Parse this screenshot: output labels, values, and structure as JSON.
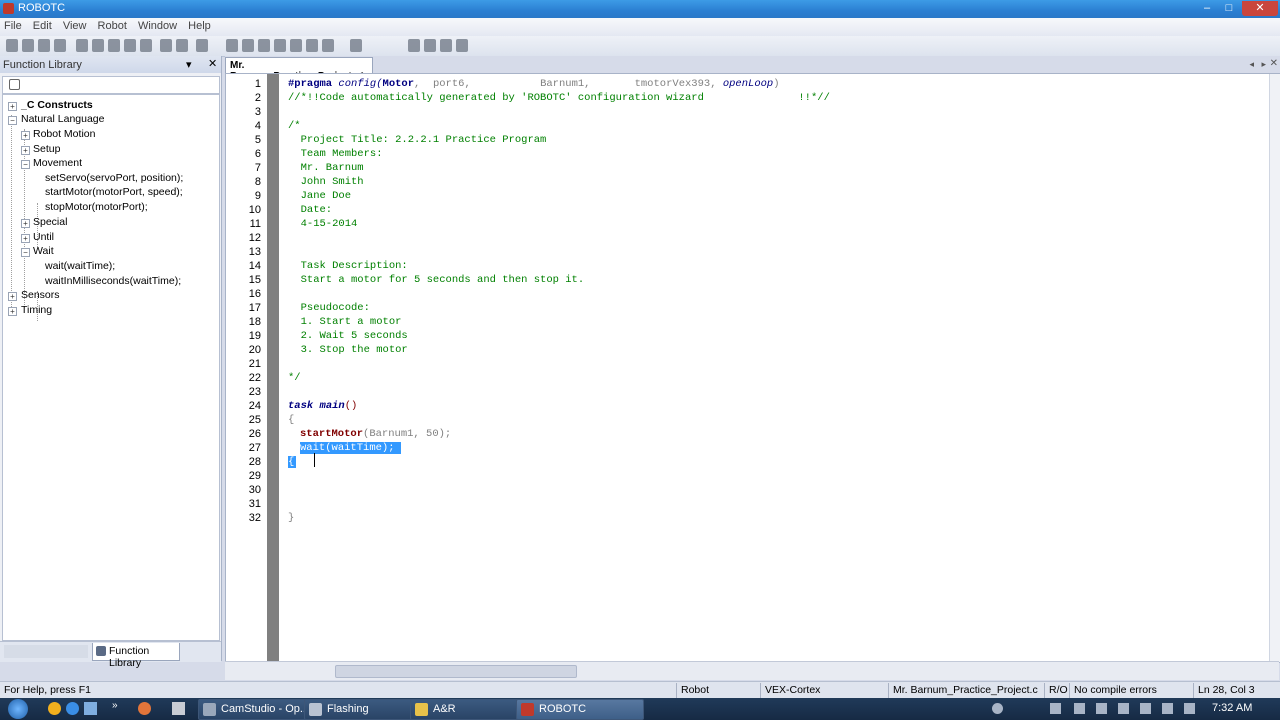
{
  "window": {
    "title": "ROBOTC",
    "minimize": "‒",
    "maximize": "□",
    "close": "✕"
  },
  "menu": [
    "File",
    "Edit",
    "View",
    "Robot",
    "Window",
    "Help"
  ],
  "function_library": {
    "title": "Function Library",
    "pin": "▾",
    "close": "✕",
    "tree": [
      {
        "label": "_C Constructs",
        "bold": true,
        "expander": "+"
      },
      {
        "label": "Natural Language",
        "expander": "−"
      },
      {
        "label": "Robot Motion",
        "expander": "+"
      },
      {
        "label": "Setup",
        "expander": "+"
      },
      {
        "label": "Movement",
        "expander": "−"
      },
      {
        "label": "setServo(servoPort, position);"
      },
      {
        "label": "startMotor(motorPort, speed);"
      },
      {
        "label": "stopMotor(motorPort);"
      },
      {
        "label": "Special",
        "expander": "+"
      },
      {
        "label": "Until",
        "expander": "+"
      },
      {
        "label": "Wait",
        "expander": "−"
      },
      {
        "label": "wait(waitTime);"
      },
      {
        "label": "waitInMilliseconds(waitTime);"
      },
      {
        "label": "Sensors",
        "expander": "+"
      },
      {
        "label": "Timing",
        "expander": "+"
      }
    ],
    "tab_label": "Function Library"
  },
  "editor": {
    "tab_label": "Mr. Barnum_Practice_Project.c*",
    "line_numbers": [
      "1",
      "2",
      "3",
      "4",
      "5",
      "6",
      "7",
      "8",
      "9",
      "10",
      "11",
      "12",
      "13",
      "14",
      "15",
      "16",
      "17",
      "18",
      "19",
      "20",
      "21",
      "22",
      "23",
      "24",
      "25",
      "26",
      "27",
      "28",
      "29",
      "30",
      "31",
      "32"
    ],
    "code": {
      "l1_pragma": "#pragma",
      "l1_config": " config(",
      "l1_motor": "Motor",
      "l1_rest": ",  port6,           Barnum1,       tmotorVex393, ",
      "l1_openloop": "openLoop",
      "l1_close": ")",
      "l2": "//*!!Code automatically generated by 'ROBOTC' configuration wizard               !!*//",
      "l4": "/*",
      "l5": "  Project Title: 2.2.2.1 Practice Program",
      "l6": "  Team Members:",
      "l7": "  Mr. Barnum",
      "l8": "  John Smith",
      "l9": "  Jane Doe",
      "l10": "  Date:",
      "l11": "  4-15-2014",
      "l14": "  Task Description:",
      "l15": "  Start a motor for 5 seconds and then stop it.",
      "l17": "  Pseudocode:",
      "l18": "  1. Start a motor",
      "l19": "  2. Wait 5 seconds",
      "l20": "  3. Stop the motor",
      "l22": "*/",
      "l24_task": "task",
      "l24_main": " main",
      "l24_paren": "()",
      "l25": "{",
      "l26_fn": "startMotor",
      "l26_args": "(Barnum1, 50);",
      "l27_fn": "wait",
      "l27_args": "(waitTime);",
      "l28": "{",
      "l32": "}"
    }
  },
  "status": {
    "help": "For Help, press F1",
    "robot": "Robot",
    "platform": "VEX-Cortex",
    "file": "Mr. Barnum_Practice_Project.c",
    "mode": "R/O",
    "errors": "No compile errors",
    "position": "Ln 28, Col 3"
  },
  "taskbar": {
    "buttons": [
      "CamStudio - Op...",
      "Flashing",
      "A&R",
      "ROBOTC"
    ],
    "clock": "7:32 AM"
  }
}
